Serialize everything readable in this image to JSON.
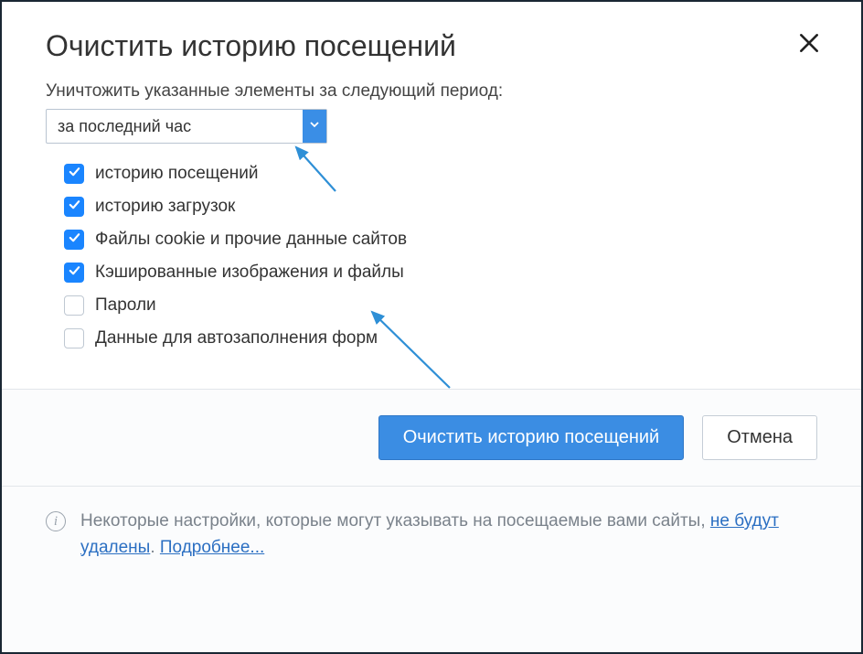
{
  "dialog": {
    "title": "Очистить историю посещений",
    "period_label": "Уничтожить указанные элементы за следующий период:",
    "period_value": "за последний час",
    "options": [
      {
        "label": "историю посещений",
        "checked": true
      },
      {
        "label": "историю загрузок",
        "checked": true
      },
      {
        "label": "Файлы cookie и прочие данные сайтов",
        "checked": true
      },
      {
        "label": "Кэшированные изображения и файлы",
        "checked": true
      },
      {
        "label": "Пароли",
        "checked": false
      },
      {
        "label": "Данные для автозаполнения форм",
        "checked": false
      }
    ],
    "primary_button": "Очистить историю посещений",
    "secondary_button": "Отмена",
    "info_text_1": "Некоторые настройки, которые могут указывать на посещаемые вами сайты, ",
    "info_link_1": "не будут удалены",
    "info_sep": ". ",
    "info_link_2": "Подробнее..."
  }
}
